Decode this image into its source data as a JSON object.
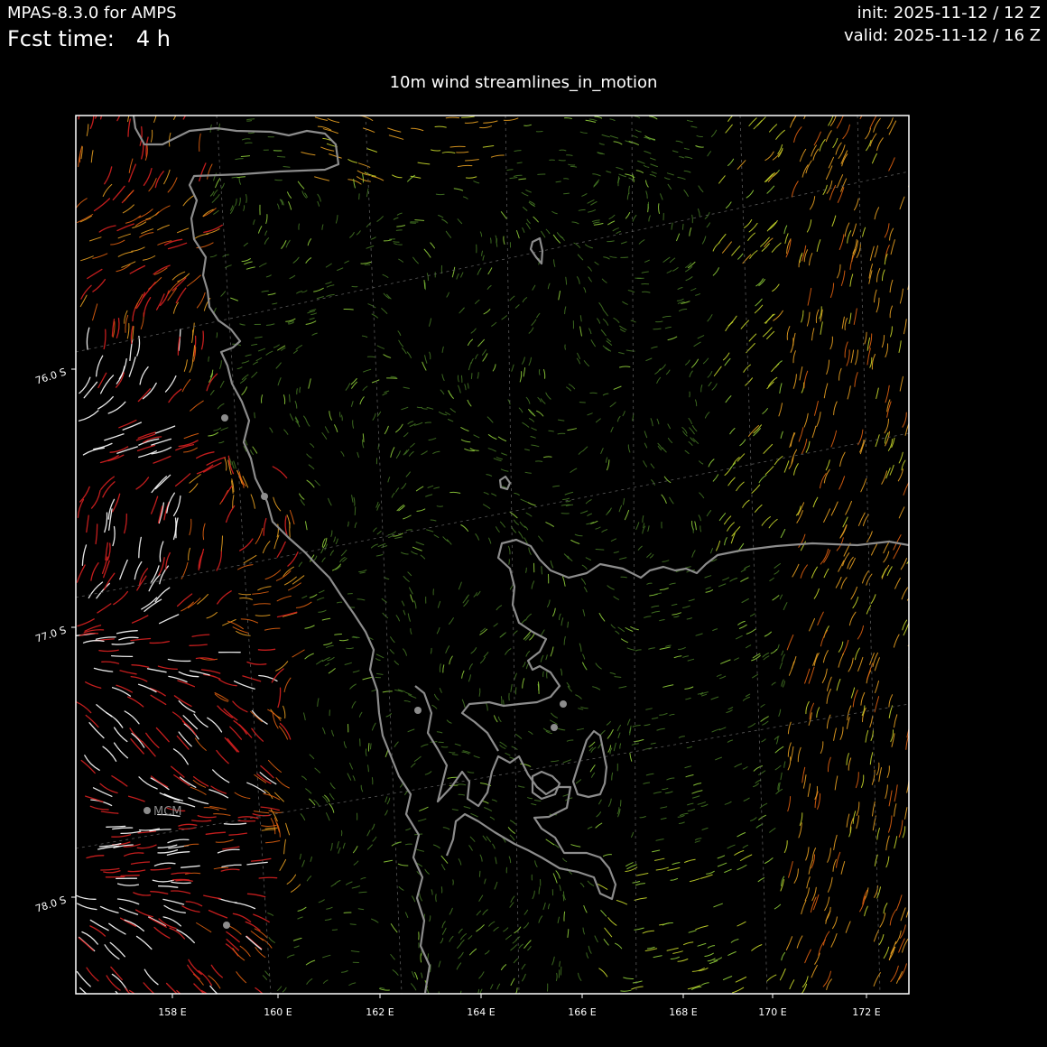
{
  "header": {
    "model": "MPAS-8.3.0 for AMPS",
    "fcst_label": "Fcst time:",
    "fcst_value": "4 h",
    "init": "init: 2025-11-12 / 12 Z",
    "valid": "valid: 2025-11-12 / 16 Z"
  },
  "plot": {
    "title": "10m wind streamlines_in_motion"
  },
  "axes": {
    "lat_ticks": [
      {
        "value": -76.0,
        "label": "76.0 S"
      },
      {
        "value": -77.0,
        "label": "77.0 S"
      },
      {
        "value": -78.0,
        "label": "78.0 S"
      }
    ],
    "lon_ticks": [
      {
        "value": 158,
        "label": "158 E"
      },
      {
        "value": 160,
        "label": "160 E"
      },
      {
        "value": 162,
        "label": "162 E"
      },
      {
        "value": 164,
        "label": "164 E"
      },
      {
        "value": 166,
        "label": "166 E"
      },
      {
        "value": 168,
        "label": "168 E"
      },
      {
        "value": 170,
        "label": "170 E"
      },
      {
        "value": 172,
        "label": "172 E"
      }
    ]
  },
  "stations": [
    {
      "label": "MCM"
    }
  ],
  "colors": {
    "background": "#000000",
    "frame": "#ffffff",
    "coastline": "#8c8c8c",
    "gridline": "#5a5a5a",
    "wind_weak": "#4f8a2a",
    "wind_light": "#8fce3a",
    "wind_moderate": "#c8d82a",
    "wind_fresh": "#e8a020",
    "wind_strong": "#e06010",
    "wind_very_strong": "#d82020",
    "wind_extreme": "#ffffff"
  }
}
